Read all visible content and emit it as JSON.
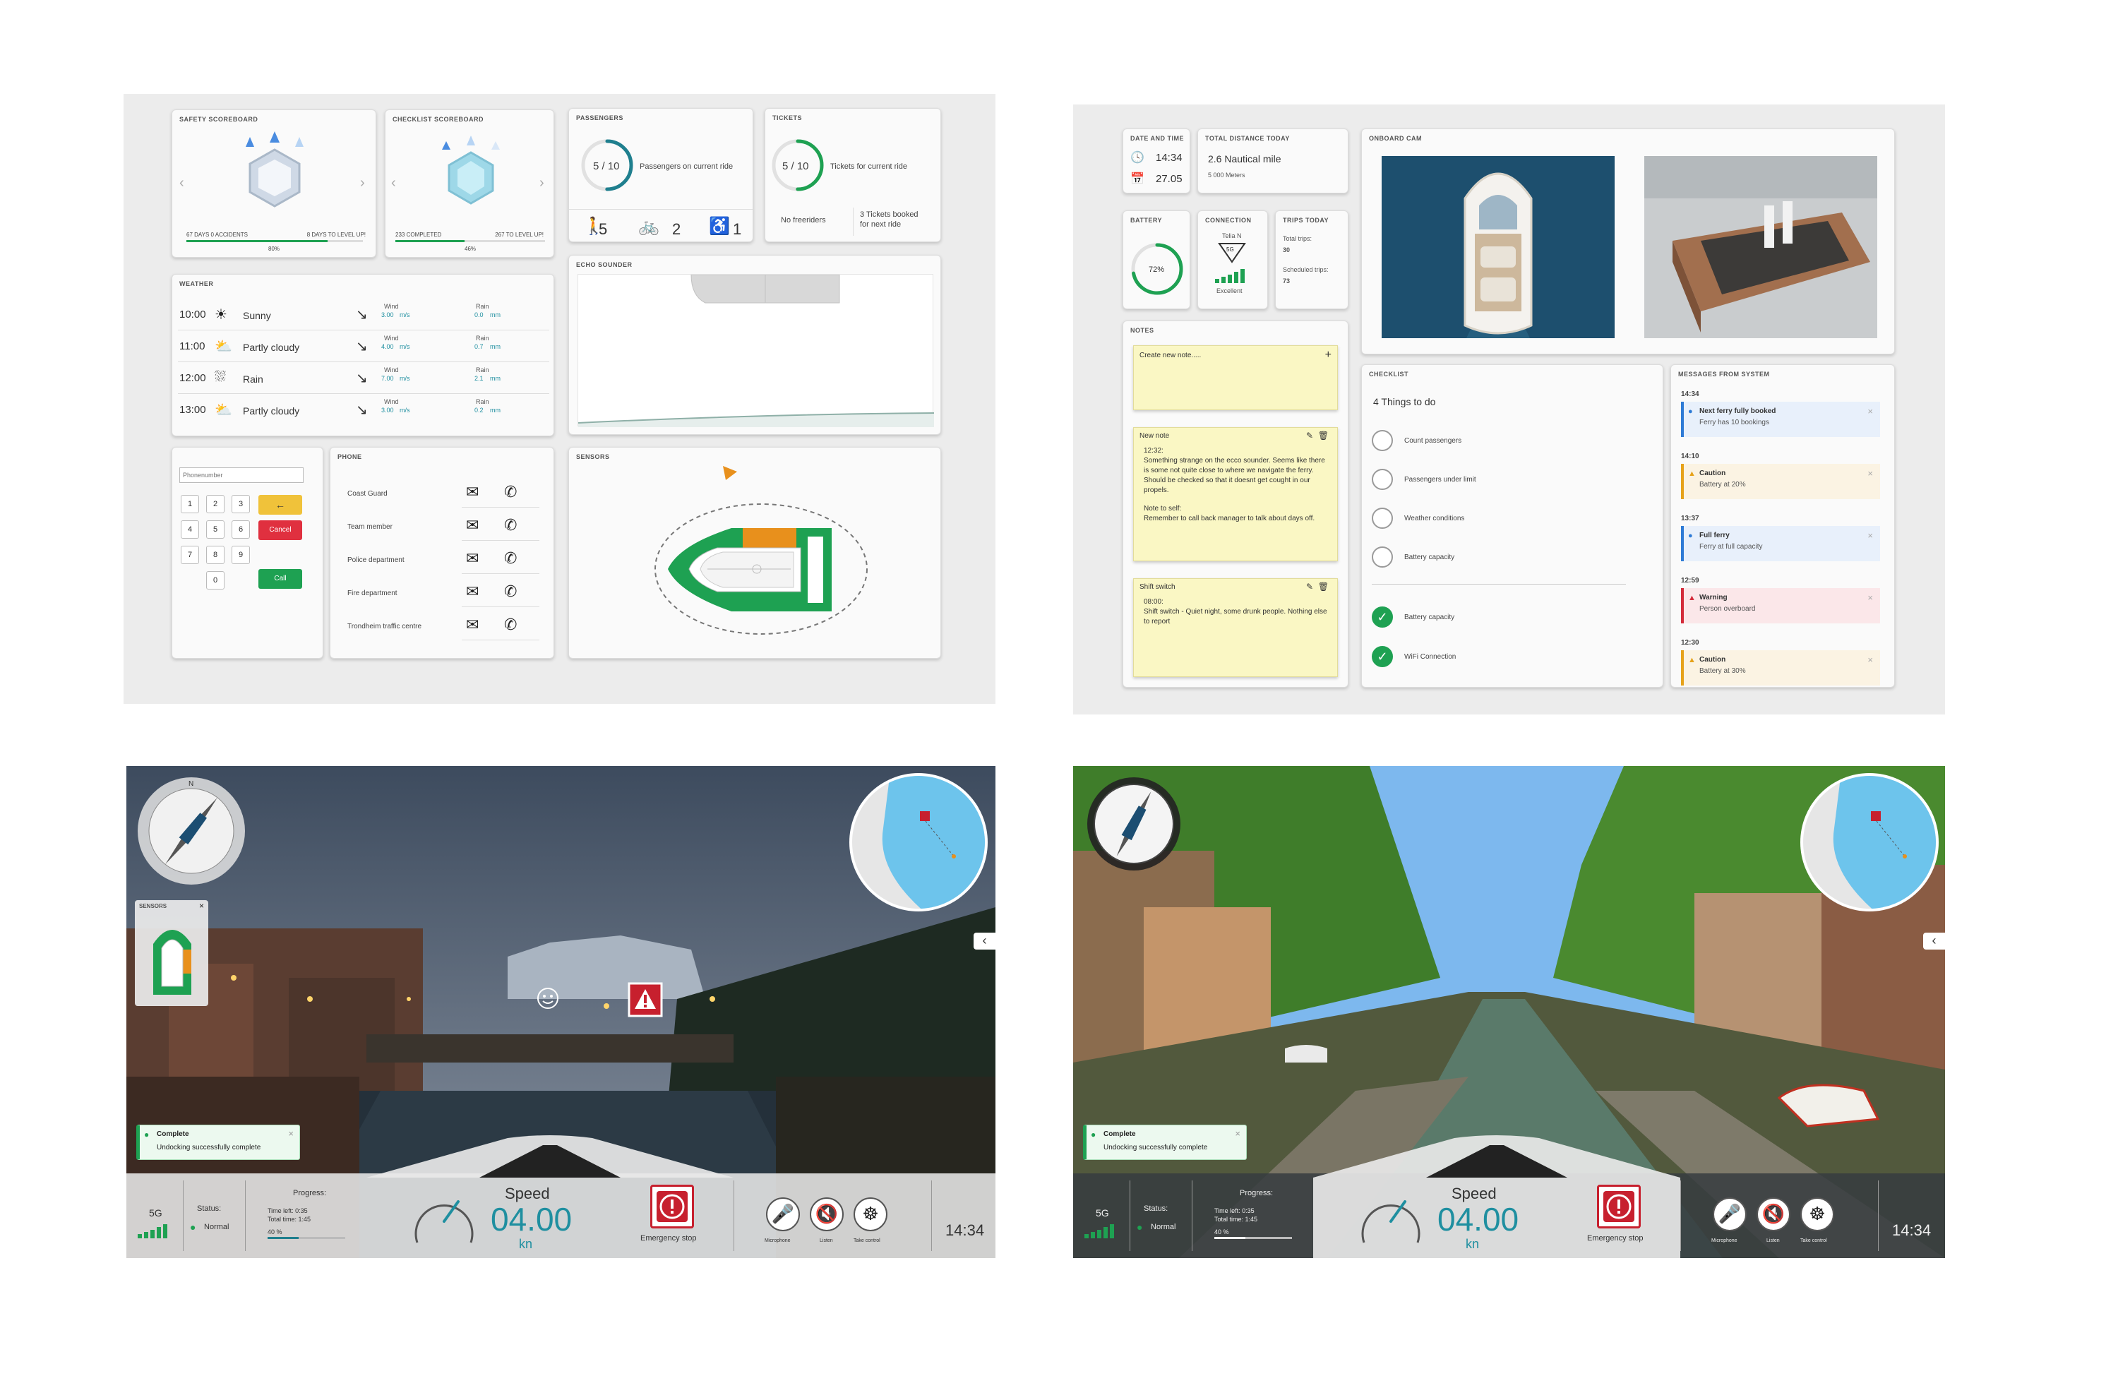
{
  "dashboard1": {
    "safety": {
      "title": "Safety scoreboard",
      "left": "67 days 0 accidents",
      "right": "8 days to level up!",
      "pct": "80%",
      "progress": 0.8
    },
    "checklist": {
      "title": "Checklist scoreboard",
      "left": "233 completed",
      "right": "267 to level up!",
      "pct": "46%",
      "progress": 0.46
    },
    "passengers": {
      "title": "Passengers",
      "count": "5 / 10",
      "label": "Passengers on current ride",
      "fraction": 0.5,
      "people": "5",
      "bikes": "2",
      "wheelchair": "1"
    },
    "tickets": {
      "title": "Tickets",
      "count": "5 / 10",
      "label": "Tickets for current ride",
      "fraction": 0.5,
      "freeriders": "No freeriders",
      "booked_1": "3 Tickets booked",
      "booked_2": "for next ride"
    },
    "weather": {
      "title": "Weather",
      "rows": [
        {
          "time": "10:00",
          "icon": "sun-icon",
          "glyph": "☀",
          "cond": "Sunny",
          "wind_lbl": "Wind",
          "wind": "3.00",
          "wind_unit": "m/s",
          "rain_lbl": "Rain",
          "rain": "0.0",
          "rain_unit": "mm"
        },
        {
          "time": "11:00",
          "icon": "partly-cloudy-icon",
          "glyph": "⛅",
          "cond": "Partly cloudy",
          "wind_lbl": "Wind",
          "wind": "4.00",
          "wind_unit": "m/s",
          "rain_lbl": "Rain",
          "rain": "0.7",
          "rain_unit": "mm"
        },
        {
          "time": "12:00",
          "icon": "rain-icon",
          "glyph": "⛆",
          "cond": "Rain",
          "wind_lbl": "Wind",
          "wind": "7.00",
          "wind_unit": "m/s",
          "rain_lbl": "Rain",
          "rain": "2.1",
          "rain_unit": "mm"
        },
        {
          "time": "13:00",
          "icon": "partly-cloudy-icon",
          "glyph": "⛅",
          "cond": "Partly cloudy",
          "wind_lbl": "Wind",
          "wind": "3.00",
          "wind_unit": "m/s",
          "rain_lbl": "Rain",
          "rain": "0.2",
          "rain_unit": "mm"
        }
      ]
    },
    "echo": {
      "title": "Echo sounder"
    },
    "keypad": {
      "placeholder": "Phonenumber",
      "keys": [
        "1",
        "2",
        "3",
        "4",
        "5",
        "6",
        "7",
        "8",
        "9",
        "0"
      ],
      "back": "←",
      "cancel": "Cancel",
      "call": "Call"
    },
    "phone": {
      "title": "Phone",
      "contacts": [
        "Coast Guard",
        "Team member",
        "Police department",
        "Fire department",
        "Trondheim traffic centre"
      ]
    },
    "sensors": {
      "title": "Sensors"
    }
  },
  "dashboard2": {
    "datetime": {
      "title": "Date and time",
      "time": "14:34",
      "date": "27.05"
    },
    "distance": {
      "title": "Total distance today",
      "value": "2.6 Nautical mile",
      "sub": "5 000 Meters"
    },
    "cam": {
      "title": "Onboard cam"
    },
    "battery": {
      "title": "Battery",
      "value": "72%",
      "level": 0.72
    },
    "connection": {
      "title": "Connection",
      "network": "Telia N",
      "gen": "5G",
      "quality": "Excellent"
    },
    "trips": {
      "title": "Trips today",
      "total_lbl": "Total trips:",
      "total": "30",
      "sched_lbl": "Scheduled trips:",
      "sched": "73"
    },
    "notes": {
      "title": "Notes",
      "create": "Create new note.....",
      "n1_title": "New note",
      "n1_time": "12:32:",
      "n1_body": "Something strange on the ecco sounder. Seems like there is some not quite close to where we navigate the ferry. Should be checked so that it doesnt get cought in our propels.",
      "n1_note": "Note to self:",
      "n1_note2": "Remember to call back manager to talk about days off.",
      "n2_title": "Shift switch",
      "n2_time": "08:00:",
      "n2_body": "Shift switch - Quiet night, some drunk people. Nothing else to report"
    },
    "checklist": {
      "title": "Checklist",
      "heading": "4 Things to do",
      "todo": [
        "Count passengers",
        "Passengers under limit",
        "Weather conditions",
        "Battery capacity"
      ],
      "done": [
        "Battery capacity",
        "WiFi Connection"
      ]
    },
    "messages": {
      "title": "Messages from system",
      "items": [
        {
          "time": "14:34",
          "kind": "info",
          "title": "Next ferry fully booked",
          "body": "Ferry has 10 bookings"
        },
        {
          "time": "14:10",
          "kind": "caution",
          "title": "Caution",
          "body": "Battery at 20%"
        },
        {
          "time": "13:37",
          "kind": "info",
          "title": "Full ferry",
          "body": "Ferry at full capacity"
        },
        {
          "time": "12:59",
          "kind": "warn",
          "title": "Warning",
          "body": "Person overboard"
        },
        {
          "time": "12:30",
          "kind": "caution",
          "title": "Caution",
          "body": "Battery at 30%"
        }
      ]
    }
  },
  "nav": {
    "compass_n": "N",
    "sensors_title": "Sensors",
    "complete_title": "Complete",
    "complete_body": "Undocking successfully complete",
    "network": "5G",
    "status_lbl": "Status:",
    "status": "Normal",
    "progress_lbl": "Progress:",
    "time_left": "Time left: 0:35",
    "total_time": "Total time: 1:45",
    "progress_pct": "40 %",
    "progress": 0.4,
    "speed_lbl": "Speed",
    "speed": "04.00",
    "unit": "kn",
    "emergency": "Emergency stop",
    "btn_mic": "Microphone",
    "btn_listen": "Listen",
    "btn_take": "Take control",
    "clock": "14:34",
    "chevron": "‹"
  },
  "colors": {
    "teal": "#1f8fa0",
    "green": "#1ea152",
    "orange": "#e8901c",
    "red": "#c7202e",
    "sea": "#6dc4ec"
  }
}
